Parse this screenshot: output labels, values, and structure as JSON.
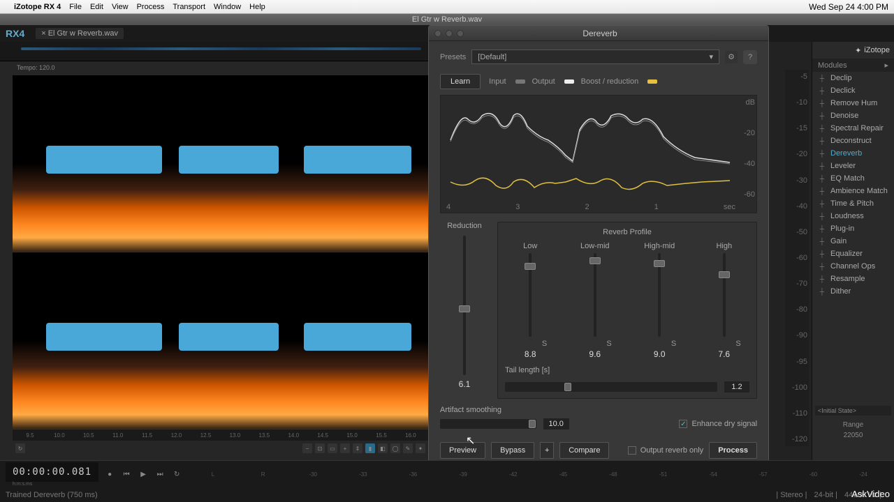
{
  "menubar": {
    "app": "iZotope RX 4",
    "items": [
      "File",
      "Edit",
      "View",
      "Process",
      "Transport",
      "Window",
      "Help"
    ],
    "clock": "Wed Sep 24  4:00 PM"
  },
  "window_title": "El Gtr w Reverb.wav",
  "tab": "El Gtr w Reverb.wav",
  "tempo": "Tempo: 120.0",
  "timeline_marks": [
    "9.5",
    "10.0",
    "10.5",
    "11.0",
    "11.5",
    "12.0",
    "12.5",
    "13.0",
    "13.5",
    "14.0",
    "14.5",
    "15.0",
    "15.5",
    "16.0"
  ],
  "timecode": "00:00:00.081",
  "timecode_unit": "h:m:s.ms",
  "ruler_marks": [
    "L",
    "R",
    "-30",
    "-33",
    "-36",
    "-39",
    "-42",
    "-45",
    "-48",
    "-51",
    "-54",
    "-57",
    "-60",
    "-24"
  ],
  "status_left": "Trained Dereverb (750 ms)",
  "status_right": {
    "stereo": "Stereo",
    "bits": "24-bit",
    "rate": "44100 Hz"
  },
  "meters": {
    "scale": [
      "-5",
      "-10",
      "-15",
      "-20",
      "-30",
      "-40",
      "-50",
      "-60",
      "-70",
      "-80",
      "-90",
      "-95",
      "-100",
      "-110",
      "-120"
    ]
  },
  "panel": {
    "title": "Dereverb",
    "presets_label": "Presets",
    "preset_value": "[Default]",
    "learn": "Learn",
    "legend": {
      "input": "Input",
      "output": "Output",
      "boost": "Boost / reduction"
    },
    "graph": {
      "y_unit": "dB",
      "y": [
        "-20",
        "-40",
        "-60"
      ],
      "x": [
        "4",
        "3",
        "2",
        "1",
        "sec"
      ]
    },
    "reduction": {
      "label": "Reduction",
      "value": "6.1"
    },
    "reverb_label": "Reverb Profile",
    "bands": [
      {
        "label": "Low",
        "value": "8.8",
        "s": "S"
      },
      {
        "label": "Low-mid",
        "value": "9.6",
        "s": "S"
      },
      {
        "label": "High-mid",
        "value": "9.0",
        "s": "S"
      },
      {
        "label": "High",
        "value": "7.6",
        "s": "S"
      }
    ],
    "tail": {
      "label": "Tail length [s]",
      "value": "1.2"
    },
    "artifact": {
      "label": "Artifact smoothing",
      "value": "10.0"
    },
    "enhance": {
      "label": "Enhance dry signal",
      "checked": true
    },
    "actions": {
      "preview": "Preview",
      "bypass": "Bypass",
      "plus": "+",
      "compare": "Compare",
      "output_only": "Output reverb only",
      "process": "Process"
    }
  },
  "sidebar": {
    "logo": "iZotope",
    "header": "Modules",
    "modules": [
      "Declip",
      "Declick",
      "Remove Hum",
      "Denoise",
      "Spectral Repair",
      "Deconstruct",
      "Dereverb",
      "Leveler",
      "EQ Match",
      "Ambience Match",
      "Time & Pitch",
      "Loudness",
      "Plug-in",
      "Gain",
      "Equalizer",
      "Channel Ops",
      "Resample",
      "Dither"
    ],
    "active": "Dereverb",
    "initial": "<Initial State>",
    "range": "Range",
    "range_value": "22050"
  },
  "watermark": "AskVideo"
}
